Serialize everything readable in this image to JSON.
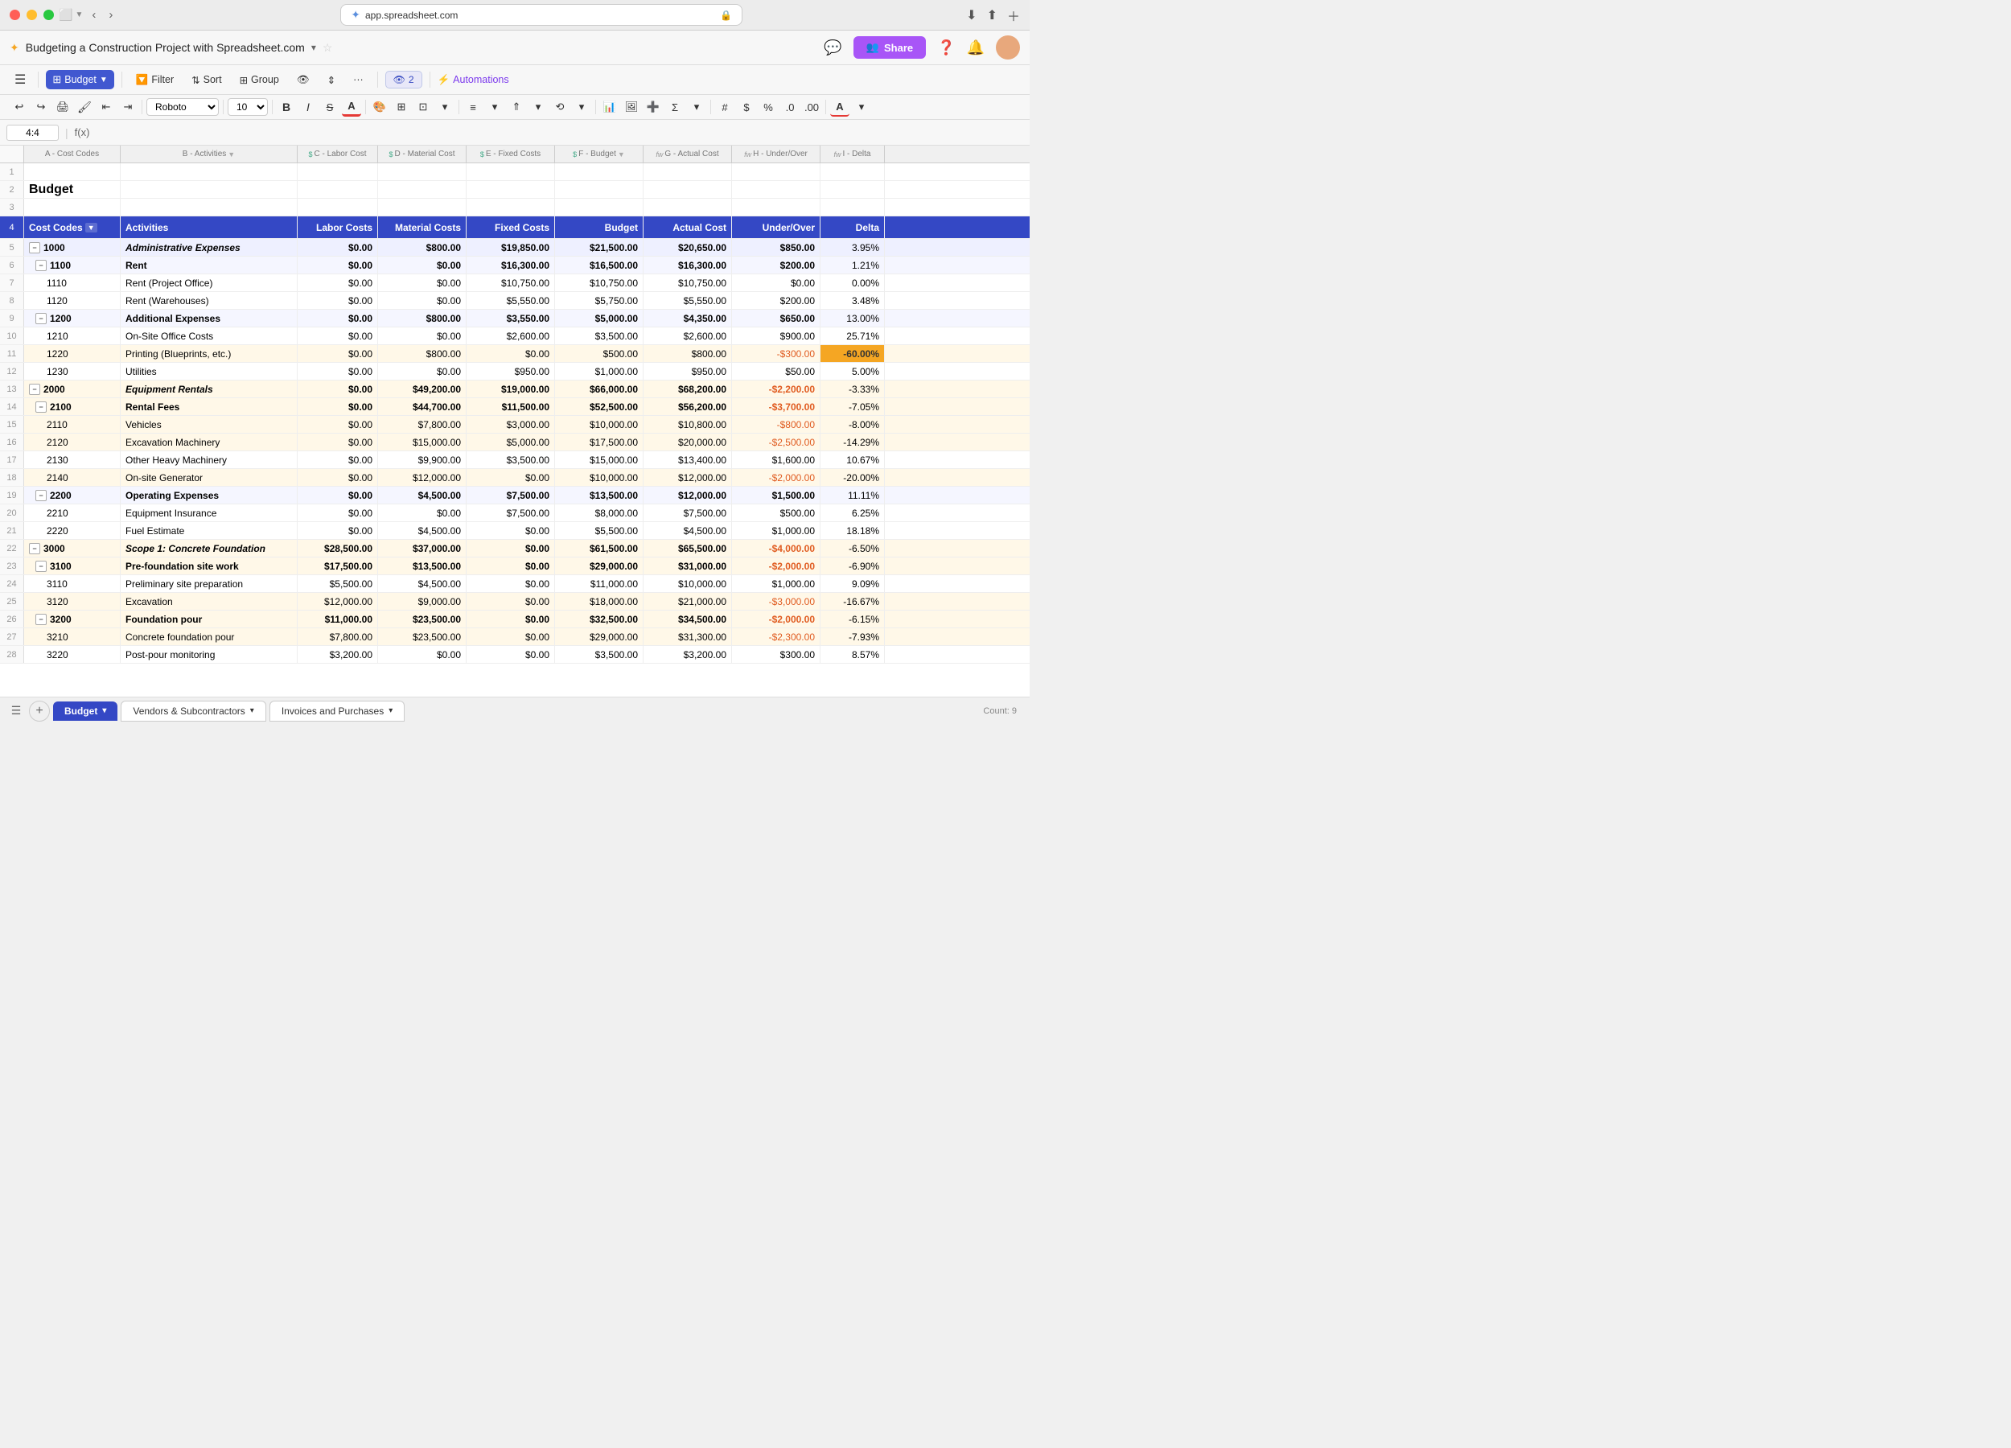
{
  "browser": {
    "url": "app.spreadsheet.com",
    "title": "Budgeting a Construction Project with Spreadsheet.com"
  },
  "toolbar": {
    "undo": "↩",
    "redo": "↪",
    "print": "🖨",
    "paint": "🖌",
    "align_left": "≡",
    "align_right": "≡",
    "font": "Roboto",
    "font_size": "10",
    "bold": "B",
    "italic": "I",
    "strikethrough": "S",
    "text_color": "A",
    "filter_btn": "Filter",
    "sort_btn": "Sort",
    "group_btn": "Group",
    "views": "2",
    "automations": "Automations",
    "sheet_name": "Budget",
    "share_label": "Share"
  },
  "formula_bar": {
    "cell_ref": "4:4",
    "fx": "f(x)"
  },
  "columns": {
    "a": "A - Cost Codes",
    "b": "B - Activities",
    "c": "C - Labor Cost",
    "d": "D - Material Cost",
    "e": "E - Fixed Costs",
    "f": "F - Budget",
    "g": "G - Actual Cost",
    "h": "H - Under/Over",
    "i": "I - Delta"
  },
  "header_row": {
    "cost_codes": "Cost Codes",
    "activities": "Activities",
    "labor_costs": "Labor Costs",
    "material_costs": "Material Costs",
    "fixed_costs": "Fixed Costs",
    "budget": "Budget",
    "actual_cost": "Actual Cost",
    "under_over": "Under/Over",
    "delta": "Delta"
  },
  "rows": [
    {
      "row": 1,
      "type": "empty"
    },
    {
      "row": 2,
      "type": "title",
      "text": "Budget"
    },
    {
      "row": 3,
      "type": "empty"
    },
    {
      "row": 4,
      "type": "header_selected"
    },
    {
      "row": 5,
      "code": "1000",
      "activity": "Administrative Expenses",
      "labor": "$0.00",
      "material": "$800.00",
      "fixed": "$19,850.00",
      "budget": "$21,500.00",
      "actual": "$20,650.00",
      "under_over": "$850.00",
      "delta": "3.95%",
      "level": 1,
      "bold": true
    },
    {
      "row": 6,
      "code": "1100",
      "activity": "Rent",
      "labor": "$0.00",
      "material": "$0.00",
      "fixed": "$16,300.00",
      "budget": "$16,500.00",
      "actual": "$16,300.00",
      "under_over": "$200.00",
      "delta": "1.21%",
      "level": 2,
      "bold": true
    },
    {
      "row": 7,
      "code": "1110",
      "activity": "Rent (Project Office)",
      "labor": "$0.00",
      "material": "$0.00",
      "fixed": "$10,750.00",
      "budget": "$10,750.00",
      "actual": "$10,750.00",
      "under_over": "$0.00",
      "delta": "0.00%",
      "level": 3
    },
    {
      "row": 8,
      "code": "1120",
      "activity": "Rent (Warehouses)",
      "labor": "$0.00",
      "material": "$0.00",
      "fixed": "$5,550.00",
      "budget": "$5,750.00",
      "actual": "$5,550.00",
      "under_over": "$200.00",
      "delta": "3.48%",
      "level": 3
    },
    {
      "row": 9,
      "code": "1200",
      "activity": "Additional Expenses",
      "labor": "$0.00",
      "material": "$800.00",
      "fixed": "$3,550.00",
      "budget": "$5,000.00",
      "actual": "$4,350.00",
      "under_over": "$650.00",
      "delta": "13.00%",
      "level": 2,
      "bold": true
    },
    {
      "row": 10,
      "code": "1210",
      "activity": "On-Site Office Costs",
      "labor": "$0.00",
      "material": "$0.00",
      "fixed": "$2,600.00",
      "budget": "$3,500.00",
      "actual": "$2,600.00",
      "under_over": "$900.00",
      "delta": "25.71%",
      "level": 3
    },
    {
      "row": 11,
      "code": "1220",
      "activity": "Printing (Blueprints, etc.)",
      "labor": "$0.00",
      "material": "$800.00",
      "fixed": "$0.00",
      "budget": "$500.00",
      "actual": "$800.00",
      "under_over": "-$300.00",
      "delta": "-60.00%",
      "level": 3,
      "over": true
    },
    {
      "row": 12,
      "code": "1230",
      "activity": "Utilities",
      "labor": "$0.00",
      "material": "$0.00",
      "fixed": "$950.00",
      "budget": "$1,000.00",
      "actual": "$950.00",
      "under_over": "$50.00",
      "delta": "5.00%",
      "level": 3
    },
    {
      "row": 13,
      "code": "2000",
      "activity": "Equipment Rentals",
      "labor": "$0.00",
      "material": "$49,200.00",
      "fixed": "$19,000.00",
      "budget": "$66,000.00",
      "actual": "$68,200.00",
      "under_over": "-$2,200.00",
      "delta": "-3.33%",
      "level": 1,
      "bold": true,
      "over": true
    },
    {
      "row": 14,
      "code": "2100",
      "activity": "Rental Fees",
      "labor": "$0.00",
      "material": "$44,700.00",
      "fixed": "$11,500.00",
      "budget": "$52,500.00",
      "actual": "$56,200.00",
      "under_over": "-$3,700.00",
      "delta": "-7.05%",
      "level": 2,
      "bold": true,
      "over": true
    },
    {
      "row": 15,
      "code": "2110",
      "activity": "Vehicles",
      "labor": "$0.00",
      "material": "$7,800.00",
      "fixed": "$3,000.00",
      "budget": "$10,000.00",
      "actual": "$10,800.00",
      "under_over": "-$800.00",
      "delta": "-8.00%",
      "level": 3,
      "over": true
    },
    {
      "row": 16,
      "code": "2120",
      "activity": "Excavation Machinery",
      "labor": "$0.00",
      "material": "$15,000.00",
      "fixed": "$5,000.00",
      "budget": "$17,500.00",
      "actual": "$20,000.00",
      "under_over": "-$2,500.00",
      "delta": "-14.29%",
      "level": 3,
      "over": true
    },
    {
      "row": 17,
      "code": "2130",
      "activity": "Other Heavy Machinery",
      "labor": "$0.00",
      "material": "$9,900.00",
      "fixed": "$3,500.00",
      "budget": "$15,000.00",
      "actual": "$13,400.00",
      "under_over": "$1,600.00",
      "delta": "10.67%",
      "level": 3
    },
    {
      "row": 18,
      "code": "2140",
      "activity": "On-site Generator",
      "labor": "$0.00",
      "material": "$12,000.00",
      "fixed": "$0.00",
      "budget": "$10,000.00",
      "actual": "$12,000.00",
      "under_over": "-$2,000.00",
      "delta": "-20.00%",
      "level": 3,
      "over": true
    },
    {
      "row": 19,
      "code": "2200",
      "activity": "Operating Expenses",
      "labor": "$0.00",
      "material": "$4,500.00",
      "fixed": "$7,500.00",
      "budget": "$13,500.00",
      "actual": "$12,000.00",
      "under_over": "$1,500.00",
      "delta": "11.11%",
      "level": 2,
      "bold": true
    },
    {
      "row": 20,
      "code": "2210",
      "activity": "Equipment Insurance",
      "labor": "$0.00",
      "material": "$0.00",
      "fixed": "$7,500.00",
      "budget": "$8,000.00",
      "actual": "$7,500.00",
      "under_over": "$500.00",
      "delta": "6.25%",
      "level": 3
    },
    {
      "row": 21,
      "code": "2220",
      "activity": "Fuel Estimate",
      "labor": "$0.00",
      "material": "$4,500.00",
      "fixed": "$0.00",
      "budget": "$5,500.00",
      "actual": "$4,500.00",
      "under_over": "$1,000.00",
      "delta": "18.18%",
      "level": 3
    },
    {
      "row": 22,
      "code": "3000",
      "activity": "Scope 1: Concrete Foundation",
      "labor": "$28,500.00",
      "material": "$37,000.00",
      "fixed": "$0.00",
      "budget": "$61,500.00",
      "actual": "$65,500.00",
      "under_over": "-$4,000.00",
      "delta": "-6.50%",
      "level": 1,
      "bold": true,
      "over": true
    },
    {
      "row": 23,
      "code": "3100",
      "activity": "Pre-foundation site work",
      "labor": "$17,500.00",
      "material": "$13,500.00",
      "fixed": "$0.00",
      "budget": "$29,000.00",
      "actual": "$31,000.00",
      "under_over": "-$2,000.00",
      "delta": "-6.90%",
      "level": 2,
      "bold": true,
      "over": true
    },
    {
      "row": 24,
      "code": "3110",
      "activity": "Preliminary site preparation",
      "labor": "$5,500.00",
      "material": "$4,500.00",
      "fixed": "$0.00",
      "budget": "$11,000.00",
      "actual": "$10,000.00",
      "under_over": "$1,000.00",
      "delta": "9.09%",
      "level": 3
    },
    {
      "row": 25,
      "code": "3120",
      "activity": "Excavation",
      "labor": "$12,000.00",
      "material": "$9,000.00",
      "fixed": "$0.00",
      "budget": "$18,000.00",
      "actual": "$21,000.00",
      "under_over": "-$3,000.00",
      "delta": "-16.67%",
      "level": 3,
      "over": true
    },
    {
      "row": 26,
      "code": "3200",
      "activity": "Foundation pour",
      "labor": "$11,000.00",
      "material": "$23,500.00",
      "fixed": "$0.00",
      "budget": "$32,500.00",
      "actual": "$34,500.00",
      "under_over": "-$2,000.00",
      "delta": "-6.15%",
      "level": 2,
      "bold": true,
      "over": true
    },
    {
      "row": 27,
      "code": "3210",
      "activity": "Concrete foundation pour",
      "labor": "$7,800.00",
      "material": "$23,500.00",
      "fixed": "$0.00",
      "budget": "$29,000.00",
      "actual": "$31,300.00",
      "under_over": "-$2,300.00",
      "delta": "-7.93%",
      "level": 3,
      "over": true
    },
    {
      "row": 28,
      "code": "3220",
      "activity": "Post-pour monitoring",
      "labor": "$3,200.00",
      "material": "$0.00",
      "fixed": "$0.00",
      "budget": "$3,500.00",
      "actual": "$3,200.00",
      "under_over": "$300.00",
      "delta": "8.57%",
      "level": 3
    }
  ],
  "tabs": [
    {
      "label": "Budget",
      "active": true
    },
    {
      "label": "Vendors & Subcontractors",
      "active": false
    },
    {
      "label": "Invoices and Purchases",
      "active": false
    }
  ],
  "status": {
    "count": "Count: 9"
  }
}
